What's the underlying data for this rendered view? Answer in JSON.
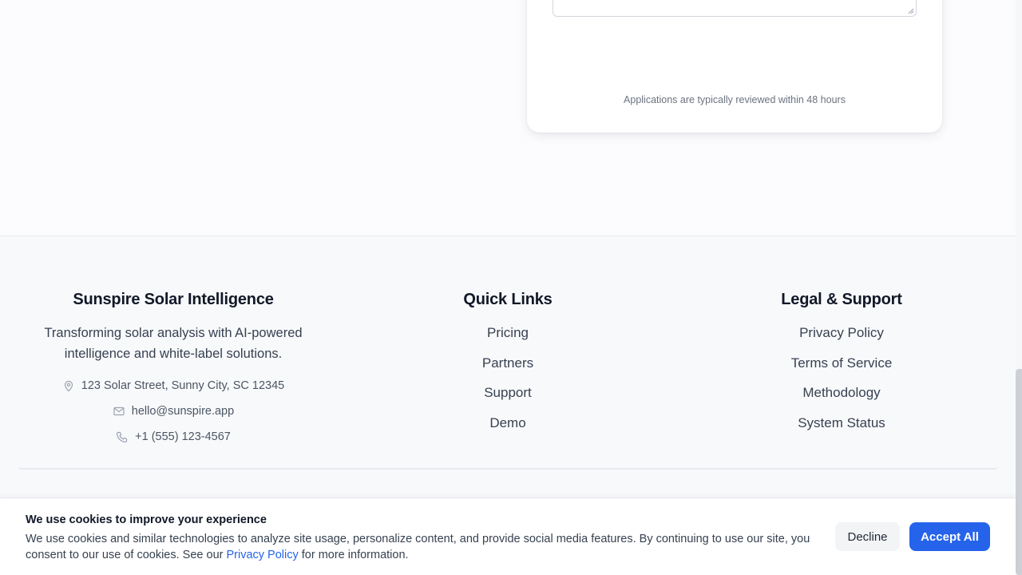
{
  "form_card": {
    "review_note": "Applications are typically reviewed within 48 hours"
  },
  "footer": {
    "brand": {
      "title": "Sunspire Solar Intelligence",
      "description": "Transforming solar analysis with AI-powered intelligence and white-label solutions.",
      "address": "123 Solar Street, Sunny City, SC 12345",
      "email": "hello@sunspire.app",
      "phone": "+1 (555) 123-4567",
      "icons": [
        "map-pin-icon",
        "mail-icon",
        "phone-icon"
      ]
    },
    "quick_links": {
      "title": "Quick Links",
      "items": [
        {
          "label": "Pricing"
        },
        {
          "label": "Partners"
        },
        {
          "label": "Support"
        },
        {
          "label": "Demo"
        }
      ]
    },
    "legal": {
      "title": "Legal & Support",
      "items": [
        {
          "label": "Privacy Policy"
        },
        {
          "label": "Terms of Service"
        },
        {
          "label": "Methodology"
        },
        {
          "label": "System Status"
        }
      ]
    }
  },
  "cookie_banner": {
    "title": "We use cookies to improve your experience",
    "text_before": "We use cookies and similar technologies to analyze site usage, personalize content, and provide social media features. By continuing to use our site, you consent to our use of cookies. See our ",
    "policy_link": "Privacy Policy",
    "text_after": " for more information.",
    "decline_label": "Decline",
    "accept_label": "Accept All"
  },
  "colors": {
    "accent": "#2563eb",
    "heading": "#111827",
    "body_text": "#374151",
    "muted_text": "#6b7280",
    "footer_bg": "#f8f9fb"
  }
}
